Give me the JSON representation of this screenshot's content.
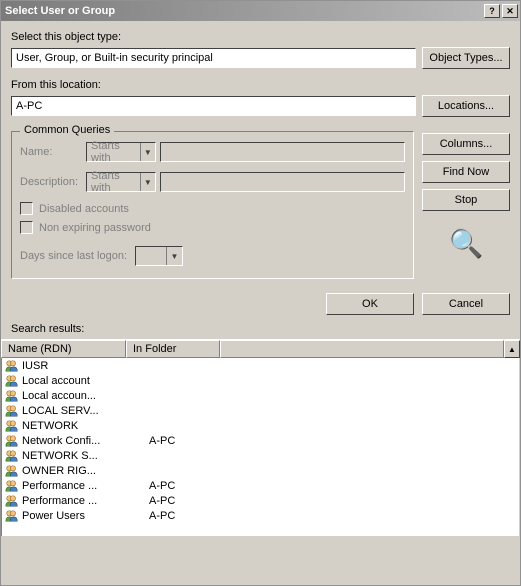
{
  "title": "Select User or Group",
  "labels": {
    "objectType": "Select this object type:",
    "fromLocation": "From this location:",
    "commonQueries": "Common Queries",
    "name": "Name:",
    "description": "Description:",
    "startsWith": "Starts with",
    "disabled": "Disabled accounts",
    "nonExpiring": "Non expiring password",
    "daysSince": "Days since last logon:",
    "searchResults": "Search results:",
    "colName": "Name (RDN)",
    "colFolder": "In Folder"
  },
  "values": {
    "objectType": "User, Group, or Built-in security principal",
    "location": "A-PC"
  },
  "buttons": {
    "objectTypes": "Object Types...",
    "locations": "Locations...",
    "columns": "Columns...",
    "findNow": "Find Now",
    "stop": "Stop",
    "ok": "OK",
    "cancel": "Cancel"
  },
  "results": [
    {
      "name": "IUSR",
      "folder": ""
    },
    {
      "name": "Local account",
      "folder": ""
    },
    {
      "name": "Local accoun...",
      "folder": ""
    },
    {
      "name": "LOCAL SERV...",
      "folder": ""
    },
    {
      "name": "NETWORK",
      "folder": ""
    },
    {
      "name": "Network Confi...",
      "folder": "A-PC"
    },
    {
      "name": "NETWORK S...",
      "folder": ""
    },
    {
      "name": "OWNER RIG...",
      "folder": ""
    },
    {
      "name": "Performance ...",
      "folder": "A-PC"
    },
    {
      "name": "Performance ...",
      "folder": "A-PC"
    },
    {
      "name": "Power Users",
      "folder": "A-PC"
    }
  ]
}
